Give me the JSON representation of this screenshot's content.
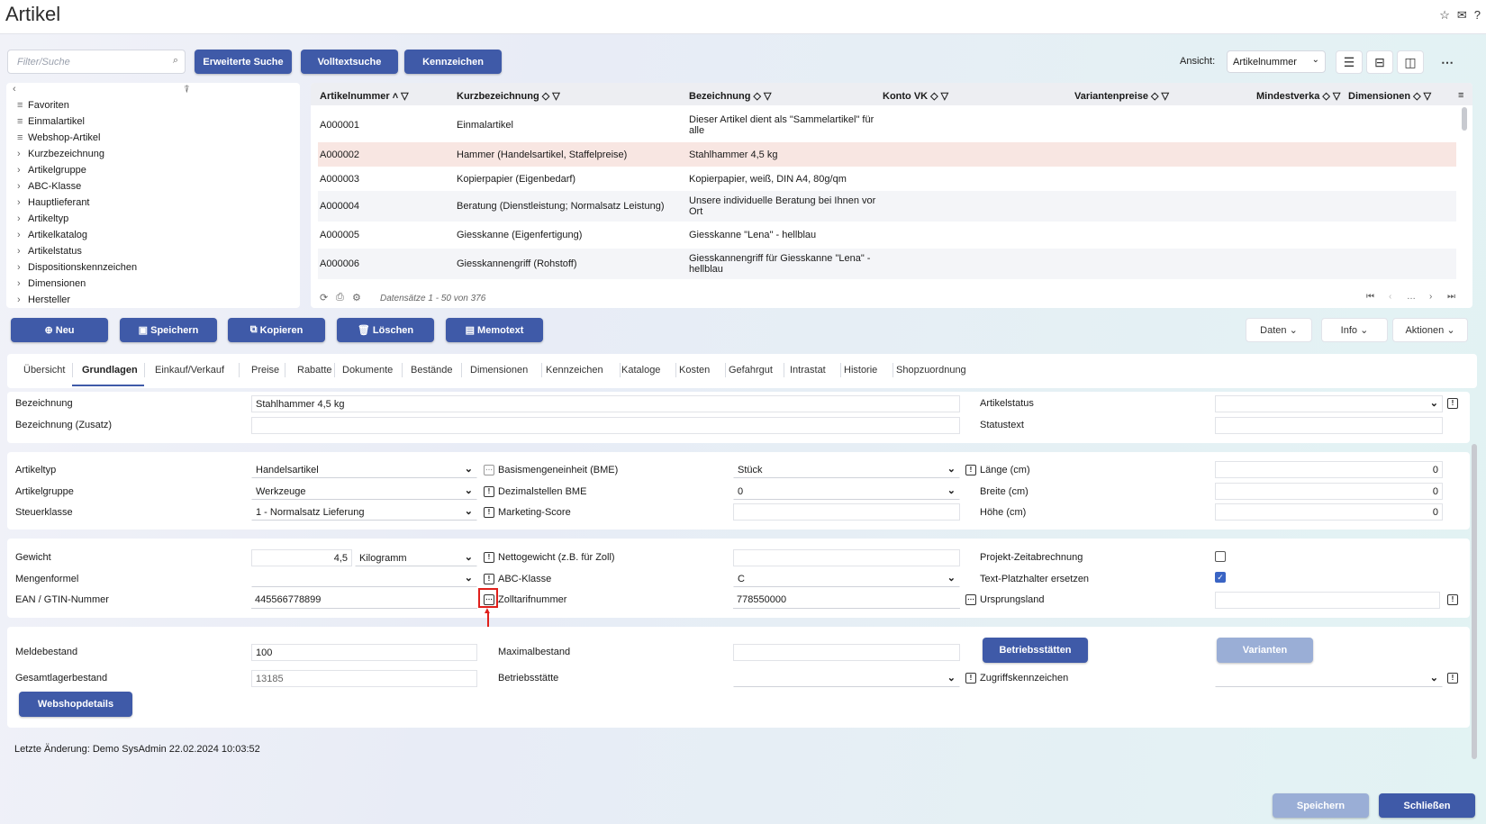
{
  "app": {
    "title": "Artikel",
    "icons": [
      "star-icon",
      "mail-icon",
      "help-icon"
    ]
  },
  "toolbar": {
    "search_placeholder": "Filter/Suche",
    "erweiterte_suche": "Erweiterte Suche",
    "volltextsuche": "Volltextsuche",
    "kennzeichen": "Kennzeichen",
    "ansicht_label": "Ansicht:",
    "ansicht_value": "Artikelnummer"
  },
  "tree": {
    "items": [
      {
        "label": "Favoriten",
        "icon": "filter-list-icon"
      },
      {
        "label": "Einmalartikel",
        "icon": "filter-list-icon"
      },
      {
        "label": "Webshop-Artikel",
        "icon": "filter-list-icon"
      },
      {
        "label": "Kurzbezeichnung",
        "icon": "chevron-right-icon"
      },
      {
        "label": "Artikelgruppe",
        "icon": "chevron-right-icon"
      },
      {
        "label": "ABC-Klasse",
        "icon": "chevron-right-icon"
      },
      {
        "label": "Hauptlieferant",
        "icon": "chevron-right-icon"
      },
      {
        "label": "Artikeltyp",
        "icon": "chevron-right-icon"
      },
      {
        "label": "Artikelkatalog",
        "icon": "chevron-right-icon"
      },
      {
        "label": "Artikelstatus",
        "icon": "chevron-right-icon"
      },
      {
        "label": "Dispositionskennzeichen",
        "icon": "chevron-right-icon"
      },
      {
        "label": "Dimensionen",
        "icon": "chevron-right-icon"
      },
      {
        "label": "Hersteller",
        "icon": "chevron-right-icon"
      }
    ]
  },
  "grid": {
    "columns": [
      "Artikelnummer",
      "Kurzbezeichnung",
      "Bezeichnung",
      "Konto VK",
      "Variantenpreise",
      "Mindestverka",
      "Dimensionen"
    ],
    "rows": [
      [
        "A000001",
        "Einmalartikel",
        "Dieser Artikel dient als \"Sammelartikel\" für alle"
      ],
      [
        "A000002",
        "Hammer (Handelsartikel, Staffelpreise)",
        "Stahlhammer 4,5 kg"
      ],
      [
        "A000003",
        "Kopierpapier (Eigenbedarf)",
        "Kopierpapier, weiß, DIN A4, 80g/qm"
      ],
      [
        "A000004",
        "Beratung (Dienstleistung; Normalsatz Leistung)",
        "Unsere individuelle Beratung bei Ihnen vor Ort"
      ],
      [
        "A000005",
        "Giesskanne (Eigenfertigung)",
        "Giesskanne \"Lena\" - hellblau"
      ],
      [
        "A000006",
        "Giesskannengriff (Rohstoff)",
        "Giesskannengriff für Giesskanne \"Lena\" - hellblau"
      ]
    ],
    "footer": "Datensätze 1 - 50 von 376",
    "pager": "…"
  },
  "actions": {
    "neu": "Neu",
    "speichern": "Speichern",
    "kopieren": "Kopieren",
    "loeschen": "Löschen",
    "memotext": "Memotext",
    "daten": "Daten",
    "info": "Info",
    "aktionen": "Aktionen"
  },
  "tabs": [
    "Übersicht",
    "Grundlagen",
    "Einkauf/Verkauf",
    "Preise",
    "Rabatte",
    "Dokumente",
    "Bestände",
    "Dimensionen",
    "Kennzeichen",
    "Kataloge",
    "Kosten",
    "Gefahrgut",
    "Intrastat",
    "Historie",
    "Shopzuordnung"
  ],
  "form": {
    "bezeichnung_label": "Bezeichnung",
    "bezeichnung": "Stahlhammer 4,5 kg",
    "bezeichnung_zusatz_label": "Bezeichnung (Zusatz)",
    "bezeichnung_zusatz": "",
    "artikelstatus_label": "Artikelstatus",
    "statustext_label": "Statustext",
    "artikeltyp_label": "Artikeltyp",
    "artikeltyp": "Handelsartikel",
    "artikelgruppe_label": "Artikelgruppe",
    "artikelgruppe": "Werkzeuge",
    "steuerklasse_label": "Steuerklasse",
    "steuerklasse": "1 - Normalsatz Lieferung",
    "bme_label": "Basismengeneinheit (BME)",
    "bme": "Stück",
    "dezimal_label": "Dezimalstellen BME",
    "dezimal": "0",
    "marketing_label": "Marketing-Score",
    "marketing": "",
    "laenge_label": "Länge (cm)",
    "laenge": "0",
    "breite_label": "Breite (cm)",
    "breite": "0",
    "hoehe_label": "Höhe (cm)",
    "hoehe": "0",
    "gewicht_label": "Gewicht",
    "gewicht": "4,5",
    "gewicht_einheit": "Kilogramm",
    "mengenformel_label": "Mengenformel",
    "ean_label": "EAN / GTIN-Nummer",
    "ean": "445566778899",
    "netto_label": "Nettogewicht (z.B. für Zoll)",
    "abc_label": "ABC-Klasse",
    "abc": "C",
    "zoll_label": "Zolltarifnummer",
    "zoll": "778550000",
    "projekt_label": "Projekt-Zeitabrechnung",
    "projekt_checked": false,
    "platzhalter_label": "Text-Platzhalter ersetzen",
    "platzhalter_checked": true,
    "ursprung_label": "Ursprungsland",
    "melde_label": "Meldebestand",
    "melde": "100",
    "gesamt_label": "Gesamtlagerbestand",
    "gesamt": "13185",
    "max_label": "Maximalbestand",
    "betriebsstaette_label": "Betriebsstätte",
    "betriebsstaetten_btn": "Betriebsstätten",
    "varianten_btn": "Varianten",
    "zugriff_label": "Zugriffskennzeichen",
    "webshop_btn": "Webshopdetails"
  },
  "status": "Letzte Änderung: Demo SysAdmin 22.02.2024 10:03:52",
  "bottom": {
    "speichern": "Speichern",
    "schliessen": "Schließen"
  },
  "colors": {
    "primary": "#3f5aa8",
    "selected_row": "#f8e6e2",
    "highlight": "#e0201c"
  }
}
